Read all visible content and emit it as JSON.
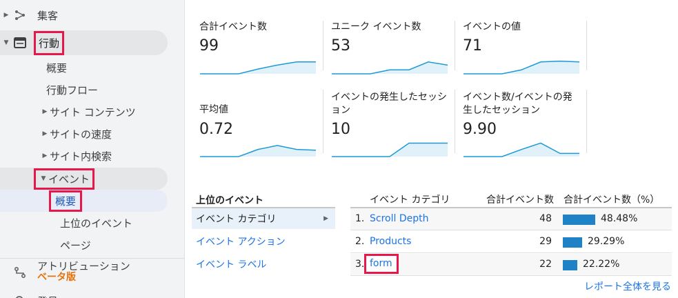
{
  "sidebar": {
    "acquisition": "集客",
    "behavior": "行動",
    "overview": "概要",
    "behavior_flow": "行動フロー",
    "site_content": "サイト コンテンツ",
    "site_speed": "サイトの速度",
    "site_search": "サイト内検索",
    "events": "イベント",
    "events_overview": "概要",
    "top_events": "上位のイベント",
    "pages": "ページ",
    "attribution": "アトリビューション",
    "attribution_beta": "ベータ版",
    "discover": "発見"
  },
  "metrics": [
    {
      "label": "合計イベント数",
      "value": "99",
      "trend": [
        0,
        0,
        0,
        0.3,
        0.55,
        0.75,
        0.75
      ]
    },
    {
      "label": "ユニーク イベント数",
      "value": "53",
      "trend": [
        0,
        0,
        0,
        0.25,
        0.25,
        0.75,
        0.55
      ]
    },
    {
      "label": "イベントの値",
      "value": "71",
      "trend": [
        0,
        0,
        0,
        0.25,
        0.75,
        0.8,
        0.75
      ]
    },
    {
      "label": "平均値",
      "value": "0.72",
      "trend": [
        0,
        0,
        0,
        0.45,
        0.7,
        0.45,
        0.4
      ]
    },
    {
      "label": "イベントの発生したセッション",
      "value": "10",
      "trend": [
        0,
        0,
        0,
        0,
        0.85,
        0.85,
        0.85
      ]
    },
    {
      "label": "イベント数/イベントの発生したセッション",
      "value": "9.90",
      "trend": [
        0,
        0,
        0,
        0.45,
        0.85,
        0.2,
        0.2
      ]
    }
  ],
  "top_events": {
    "heading": "上位のイベント",
    "nav": [
      {
        "label": "イベント カテゴリ",
        "active": true
      },
      {
        "label": "イベント アクション",
        "active": false
      },
      {
        "label": "イベント ラベル",
        "active": false
      }
    ]
  },
  "table": {
    "headers": [
      "イベント カテゴリ",
      "合計イベント数",
      "合計イベント数（%）"
    ],
    "rows": [
      {
        "index": "1.",
        "category": "Scroll Depth",
        "total": "48",
        "percent": "48.48%",
        "share": 0.4848
      },
      {
        "index": "2.",
        "category": "Products",
        "total": "29",
        "percent": "29.29%",
        "share": 0.2929
      },
      {
        "index": "3.",
        "category": "form",
        "total": "22",
        "percent": "22.22%",
        "share": 0.2222
      }
    ],
    "full_report_link": "レポート全体を見る"
  },
  "colors": {
    "sparkline_stroke": "#1a9ad6",
    "sparkline_fill": "#e1f1fa",
    "bar": "#1f82c7",
    "highlight": "#e8174b",
    "link": "#1a73e8",
    "beta": "#e8710a"
  },
  "icons": [
    "chevron-right-icon",
    "acquisition-icon",
    "chevron-down-icon",
    "behavior-icon",
    "attribution-icon",
    "discover-icon"
  ]
}
